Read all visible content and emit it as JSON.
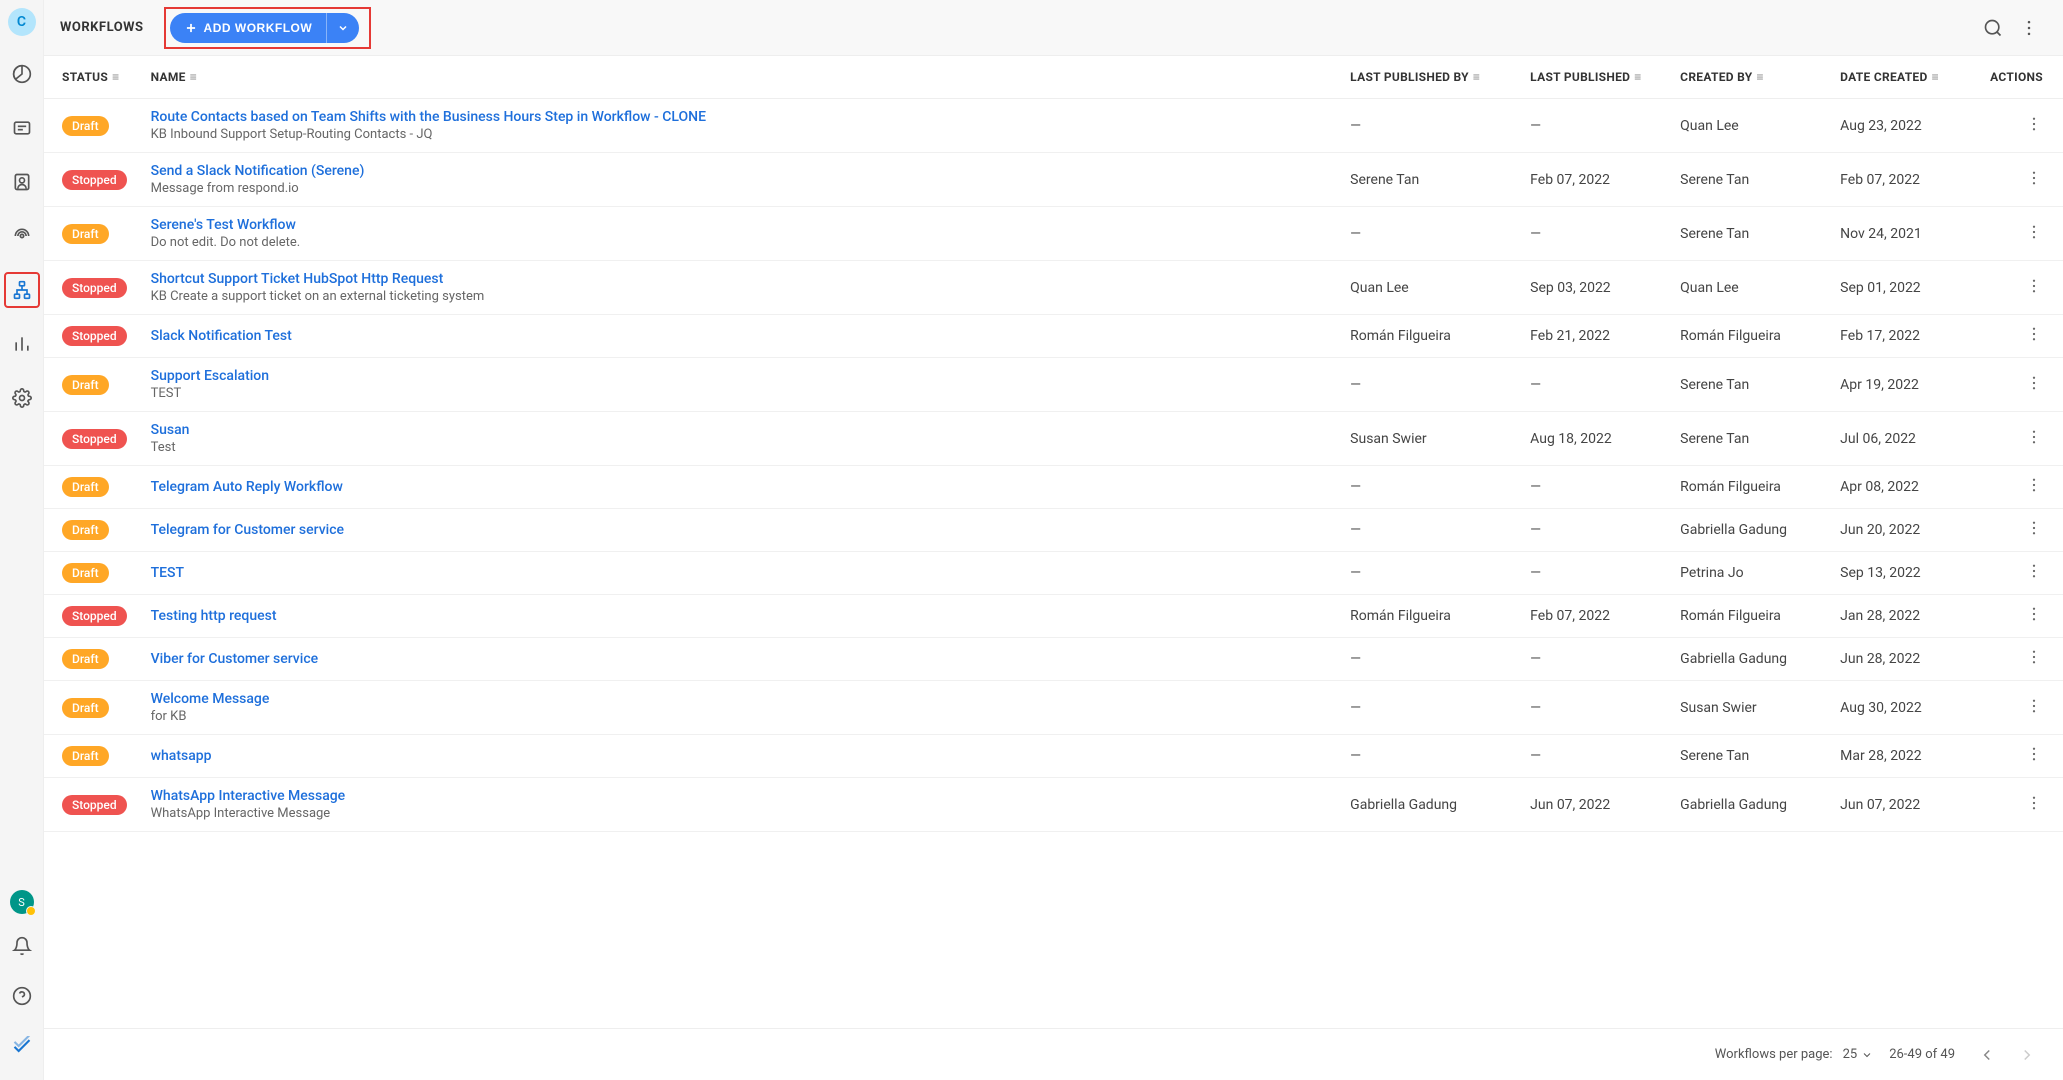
{
  "sidebar": {
    "avatar_letter": "C",
    "presence_letter": "S"
  },
  "toolbar": {
    "title": "WORKFLOWS",
    "add_label": "ADD WORKFLOW"
  },
  "columns": {
    "status": "STATUS",
    "name": "NAME",
    "last_published_by": "LAST PUBLISHED BY",
    "last_published": "LAST PUBLISHED",
    "created_by": "CREATED BY",
    "date_created": "DATE CREATED",
    "actions": "ACTIONS"
  },
  "rows": [
    {
      "status": "Draft",
      "name": "Route Contacts based on Team Shifts with the Business Hours Step in Workflow - CLONE",
      "desc": "KB Inbound Support Setup-Routing Contacts - JQ",
      "last_published_by": "—",
      "last_published": "—",
      "created_by": "Quan Lee",
      "date_created": "Aug 23, 2022"
    },
    {
      "status": "Stopped",
      "name": "Send a Slack Notification (Serene)",
      "desc": "Message from respond.io",
      "last_published_by": "Serene Tan",
      "last_published": "Feb 07, 2022",
      "created_by": "Serene Tan",
      "date_created": "Feb 07, 2022"
    },
    {
      "status": "Draft",
      "name": "Serene's Test Workflow",
      "desc": "Do not edit. Do not delete.",
      "last_published_by": "—",
      "last_published": "—",
      "created_by": "Serene Tan",
      "date_created": "Nov 24, 2021"
    },
    {
      "status": "Stopped",
      "name": "Shortcut Support Ticket HubSpot Http Request",
      "desc": "KB Create a support ticket on an external ticketing system",
      "last_published_by": "Quan Lee",
      "last_published": "Sep 03, 2022",
      "created_by": "Quan Lee",
      "date_created": "Sep 01, 2022"
    },
    {
      "status": "Stopped",
      "name": "Slack Notification Test",
      "desc": "",
      "last_published_by": "Román Filgueira",
      "last_published": "Feb 21, 2022",
      "created_by": "Román Filgueira",
      "date_created": "Feb 17, 2022"
    },
    {
      "status": "Draft",
      "name": "Support Escalation",
      "desc": "TEST",
      "last_published_by": "—",
      "last_published": "—",
      "created_by": "Serene Tan",
      "date_created": "Apr 19, 2022"
    },
    {
      "status": "Stopped",
      "name": "Susan",
      "desc": "Test",
      "last_published_by": "Susan Swier",
      "last_published": "Aug 18, 2022",
      "created_by": "Serene Tan",
      "date_created": "Jul 06, 2022"
    },
    {
      "status": "Draft",
      "name": "Telegram Auto Reply Workflow",
      "desc": "",
      "last_published_by": "—",
      "last_published": "—",
      "created_by": "Román Filgueira",
      "date_created": "Apr 08, 2022"
    },
    {
      "status": "Draft",
      "name": "Telegram for Customer service",
      "desc": "",
      "last_published_by": "—",
      "last_published": "—",
      "created_by": "Gabriella Gadung",
      "date_created": "Jun 20, 2022"
    },
    {
      "status": "Draft",
      "name": "TEST",
      "desc": "",
      "last_published_by": "—",
      "last_published": "—",
      "created_by": "Petrina Jo",
      "date_created": "Sep 13, 2022"
    },
    {
      "status": "Stopped",
      "name": "Testing http request",
      "desc": "",
      "last_published_by": "Román Filgueira",
      "last_published": "Feb 07, 2022",
      "created_by": "Román Filgueira",
      "date_created": "Jan 28, 2022"
    },
    {
      "status": "Draft",
      "name": "Viber for Customer service",
      "desc": "",
      "last_published_by": "—",
      "last_published": "—",
      "created_by": "Gabriella Gadung",
      "date_created": "Jun 28, 2022"
    },
    {
      "status": "Draft",
      "name": "Welcome Message",
      "desc": "for KB",
      "last_published_by": "—",
      "last_published": "—",
      "created_by": "Susan Swier",
      "date_created": "Aug 30, 2022"
    },
    {
      "status": "Draft",
      "name": "whatsapp",
      "desc": "",
      "last_published_by": "—",
      "last_published": "—",
      "created_by": "Serene Tan",
      "date_created": "Mar 28, 2022"
    },
    {
      "status": "Stopped",
      "name": "WhatsApp Interactive Message",
      "desc": "WhatsApp Interactive Message",
      "last_published_by": "Gabriella Gadung",
      "last_published": "Jun 07, 2022",
      "created_by": "Gabriella Gadung",
      "date_created": "Jun 07, 2022"
    }
  ],
  "footer": {
    "per_page_label": "Workflows per page:",
    "per_page_value": "25",
    "range": "26-49 of 49"
  }
}
